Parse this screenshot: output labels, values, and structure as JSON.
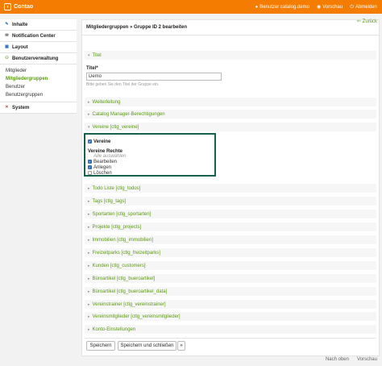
{
  "app": {
    "name": "Contao",
    "logo_glyph": "◗"
  },
  "topnav": [
    {
      "label": "Benutzer catalog.demo",
      "icon": "user-icon",
      "glyph": "●"
    },
    {
      "label": "Vorschau",
      "icon": "preview-icon",
      "glyph": "◉"
    },
    {
      "label": "Abmelden",
      "icon": "logout-icon",
      "glyph": "⏻"
    }
  ],
  "sidebar": {
    "groups": [
      {
        "label": "Inhalte",
        "icon": "content-icon",
        "glyph": "✎",
        "color": "#1a73c8"
      },
      {
        "label": "Notification Center",
        "icon": "notification-icon",
        "glyph": "✉",
        "color": "#555555"
      },
      {
        "label": "Layout",
        "icon": "layout-icon",
        "glyph": "▦",
        "color": "#2a6ebf"
      },
      {
        "label": "Benutzerverwaltung",
        "icon": "users-icon",
        "glyph": "⚇",
        "color": "#589b0e"
      },
      {
        "label": "System",
        "icon": "system-icon",
        "glyph": "✕",
        "color": "#c0392b"
      }
    ],
    "user_items": [
      "Mitglieder",
      "Mitgliedergruppen",
      "Benutzer",
      "Benutzergruppen"
    ]
  },
  "main": {
    "title": "Mitgliedergruppen » Gruppe ID 2 bearbeiten",
    "back_label": "Zurück",
    "back_glyph": "⇦"
  },
  "form": {
    "title_label": "Titel*",
    "title_value": "Demo",
    "title_help": "Bitte geben Sie den Titel der Gruppe ein."
  },
  "legends": [
    "Titel",
    "Weiterleitung",
    "Catalog Manager-Berechtigungen",
    "Vereine [ctlg_vereine]",
    "Todo Liste [ctlg_todos]",
    "Tags [ctlg_tags]",
    "Sportarten [ctlg_sportarten]",
    "Projekte [ctlg_projects]",
    "Immobilien [ctlg_immobilien]",
    "Freizeitparks [ctlg_freizeitparks]",
    "Kunden [ctlg_customers]",
    "Büroartikel [ctlg_bueroartikel]",
    "Büroartikel [ctlg_bueroartikel_data]",
    "Vereinstrainer [ctlg_vereinstrainer]",
    "Vereinsmitglieder [ctlg_vereinsmitglieder]",
    "Konto-Einstellungen"
  ],
  "vereine": {
    "enable_label": "Vereine",
    "rights_label": "Vereine Rechte",
    "select_all": "Alle auswählen",
    "options": [
      {
        "label": "Bearbeiten",
        "checked": true
      },
      {
        "label": "Anlegen",
        "checked": true
      },
      {
        "label": "Löschen",
        "checked": false
      }
    ]
  },
  "buttons": {
    "save": "Speichern",
    "save_close": "Speichern und schließen",
    "more": "»"
  },
  "footer": {
    "top": "Nach oben",
    "preview": "Vorschau"
  },
  "colors": {
    "brand": "#f47c00",
    "accent": "#589b0e",
    "focus_border": "#18614e",
    "checkbox": "#2a6ebf"
  }
}
